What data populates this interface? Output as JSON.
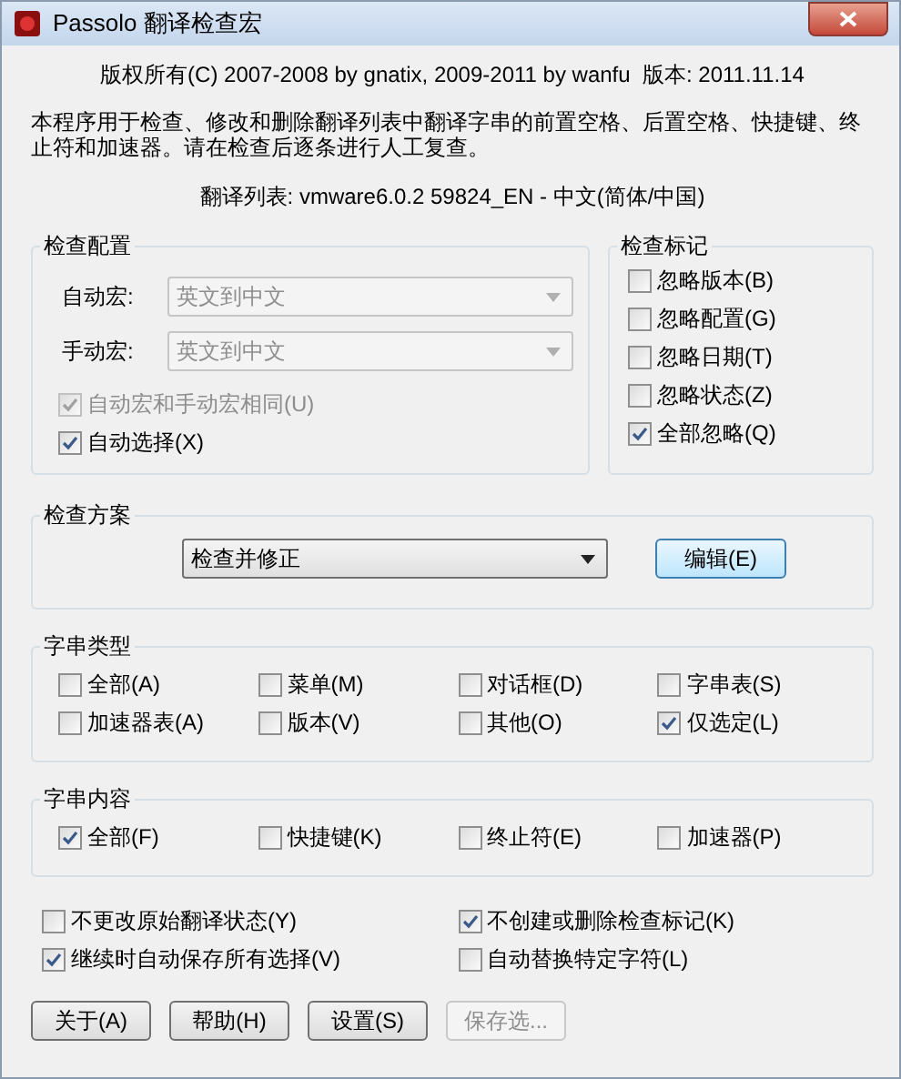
{
  "window": {
    "title": "Passolo 翻译检查宏"
  },
  "copyright": "版权所有(C) 2007-2008 by gnatix, 2009-2011 by wanfu  版本: 2011.11.14",
  "description": "本程序用于检查、修改和删除翻译列表中翻译字串的前置空格、后置空格、快捷键、终止符和加速器。请在检查后逐条进行人工复查。",
  "list_info": "翻译列表: vmware6.0.2 59824_EN - 中文(简体/中国)",
  "config": {
    "title": "检查配置",
    "fields": [
      {
        "label": "自动宏:",
        "value": "英文到中文",
        "disabled": true
      },
      {
        "label": "手动宏:",
        "value": "英文到中文",
        "disabled": true
      }
    ],
    "checks": [
      {
        "label": "自动宏和手动宏相同(U)",
        "checked": true,
        "disabled": true
      },
      {
        "label": "自动选择(X)",
        "checked": true,
        "disabled": false
      }
    ]
  },
  "marks": {
    "title": "检查标记",
    "items": [
      {
        "label": "忽略版本(B)",
        "checked": false
      },
      {
        "label": "忽略配置(G)",
        "checked": false
      },
      {
        "label": "忽略日期(T)",
        "checked": false
      },
      {
        "label": "忽略状态(Z)",
        "checked": false
      },
      {
        "label": "全部忽略(Q)",
        "checked": true
      }
    ]
  },
  "scheme": {
    "title": "检查方案",
    "value": "检查并修正",
    "button": "编辑(E)"
  },
  "string_types": {
    "title": "字串类型",
    "items": [
      {
        "label": "全部(A)",
        "checked": false
      },
      {
        "label": "菜单(M)",
        "checked": false
      },
      {
        "label": "对话框(D)",
        "checked": false
      },
      {
        "label": "字串表(S)",
        "checked": false
      },
      {
        "label": "加速器表(A)",
        "checked": false
      },
      {
        "label": "版本(V)",
        "checked": false
      },
      {
        "label": "其他(O)",
        "checked": false
      },
      {
        "label": "仅选定(L)",
        "checked": true
      }
    ]
  },
  "string_content": {
    "title": "字串内容",
    "items": [
      {
        "label": "全部(F)",
        "checked": true
      },
      {
        "label": "快捷键(K)",
        "checked": false
      },
      {
        "label": "终止符(E)",
        "checked": false
      },
      {
        "label": "加速器(P)",
        "checked": false
      }
    ]
  },
  "options": [
    {
      "label": "不更改原始翻译状态(Y)",
      "checked": false
    },
    {
      "label": "不创建或删除检查标记(K)",
      "checked": true
    },
    {
      "label": "继续时自动保存所有选择(V)",
      "checked": true
    },
    {
      "label": "自动替换特定字符(L)",
      "checked": false
    }
  ],
  "buttons": [
    {
      "label": "关于(A)",
      "disabled": false
    },
    {
      "label": "帮助(H)",
      "disabled": false
    },
    {
      "label": "设置(S)",
      "disabled": false
    },
    {
      "label": "保存选...",
      "disabled": true
    }
  ]
}
